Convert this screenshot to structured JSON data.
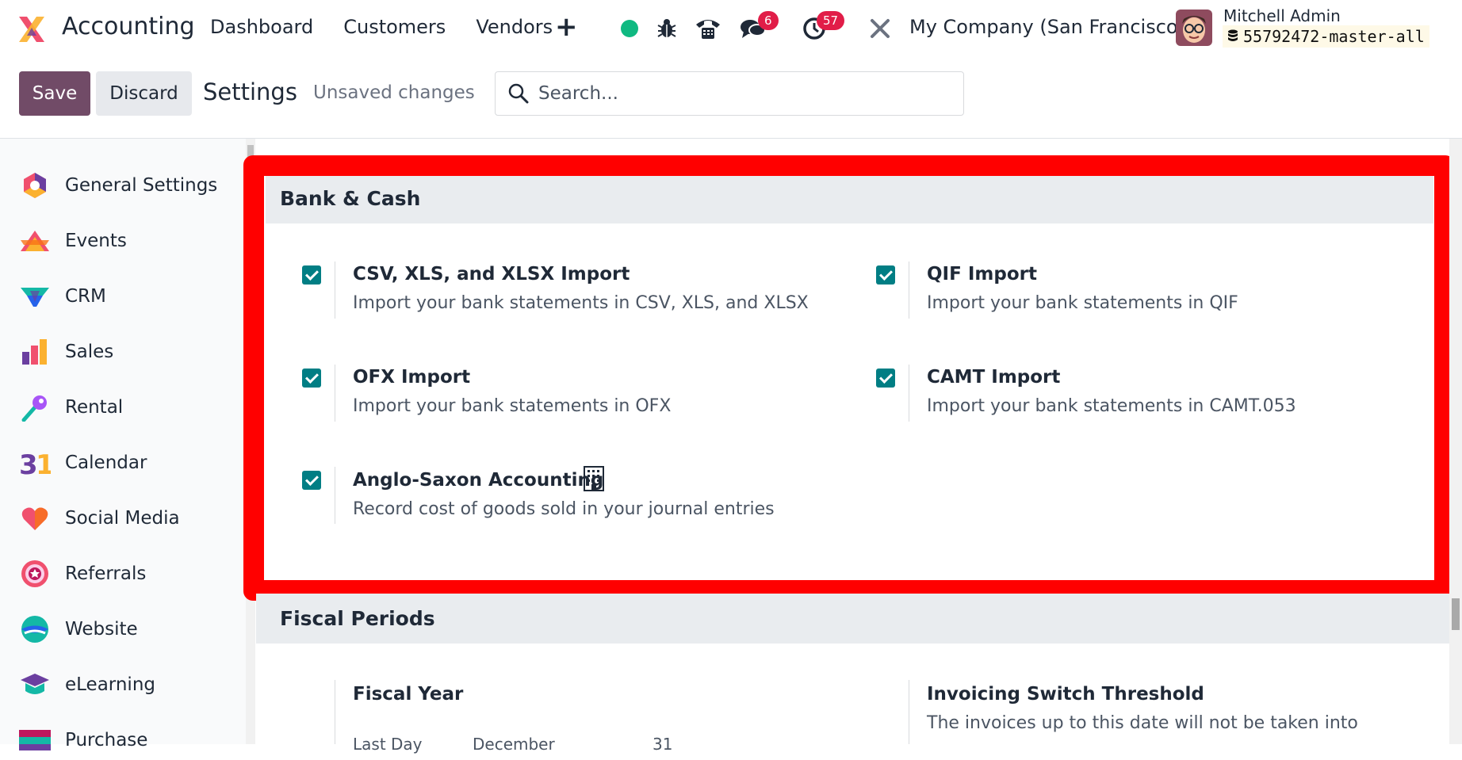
{
  "navbar": {
    "app_name": "Accounting",
    "menu": [
      "Dashboard",
      "Customers",
      "Vendors"
    ],
    "chat_badge": "6",
    "activity_badge": "57",
    "company": "My Company (San Francisco)",
    "user_name": "Mitchell Admin",
    "db_name": "55792472-master-all"
  },
  "control": {
    "save_label": "Save",
    "discard_label": "Discard",
    "title": "Settings",
    "status": "Unsaved changes",
    "search_placeholder": "Search..."
  },
  "sidebar": {
    "items": [
      {
        "label": "General Settings",
        "icon": "general-settings-icon"
      },
      {
        "label": "Events",
        "icon": "events-icon"
      },
      {
        "label": "CRM",
        "icon": "crm-icon"
      },
      {
        "label": "Sales",
        "icon": "sales-icon"
      },
      {
        "label": "Rental",
        "icon": "rental-icon"
      },
      {
        "label": "Calendar",
        "icon": "calendar-icon"
      },
      {
        "label": "Social Media",
        "icon": "social-media-icon"
      },
      {
        "label": "Referrals",
        "icon": "referrals-icon"
      },
      {
        "label": "Website",
        "icon": "website-icon"
      },
      {
        "label": "eLearning",
        "icon": "elearning-icon"
      },
      {
        "label": "Purchase",
        "icon": "purchase-icon"
      }
    ]
  },
  "bank_cash": {
    "title": "Bank & Cash",
    "settings": [
      {
        "title": "CSV, XLS, and XLSX Import",
        "desc": "Import your bank statements in CSV, XLS, and XLSX",
        "checked": true
      },
      {
        "title": "QIF Import",
        "desc": "Import your bank statements in QIF",
        "checked": true
      },
      {
        "title": "OFX Import",
        "desc": "Import your bank statements in OFX",
        "checked": true
      },
      {
        "title": "CAMT Import",
        "desc": "Import your bank statements in CAMT.053",
        "checked": true
      },
      {
        "title": "Anglo-Saxon Accounting",
        "desc": "Record cost of goods sold in your journal entries",
        "checked": true
      }
    ]
  },
  "fiscal": {
    "title": "Fiscal Periods",
    "fiscal_year": "Fiscal Year",
    "last_day_label": "Last Day",
    "last_day_month": "December",
    "last_day_day": "31",
    "threshold_title": "Invoicing Switch Threshold",
    "threshold_desc": "The invoices up to this date will not be taken into"
  },
  "colors": {
    "brand": "#714b67",
    "checkbox": "#017e84",
    "highlight": "#ff0000",
    "badge": "#e11d48"
  }
}
